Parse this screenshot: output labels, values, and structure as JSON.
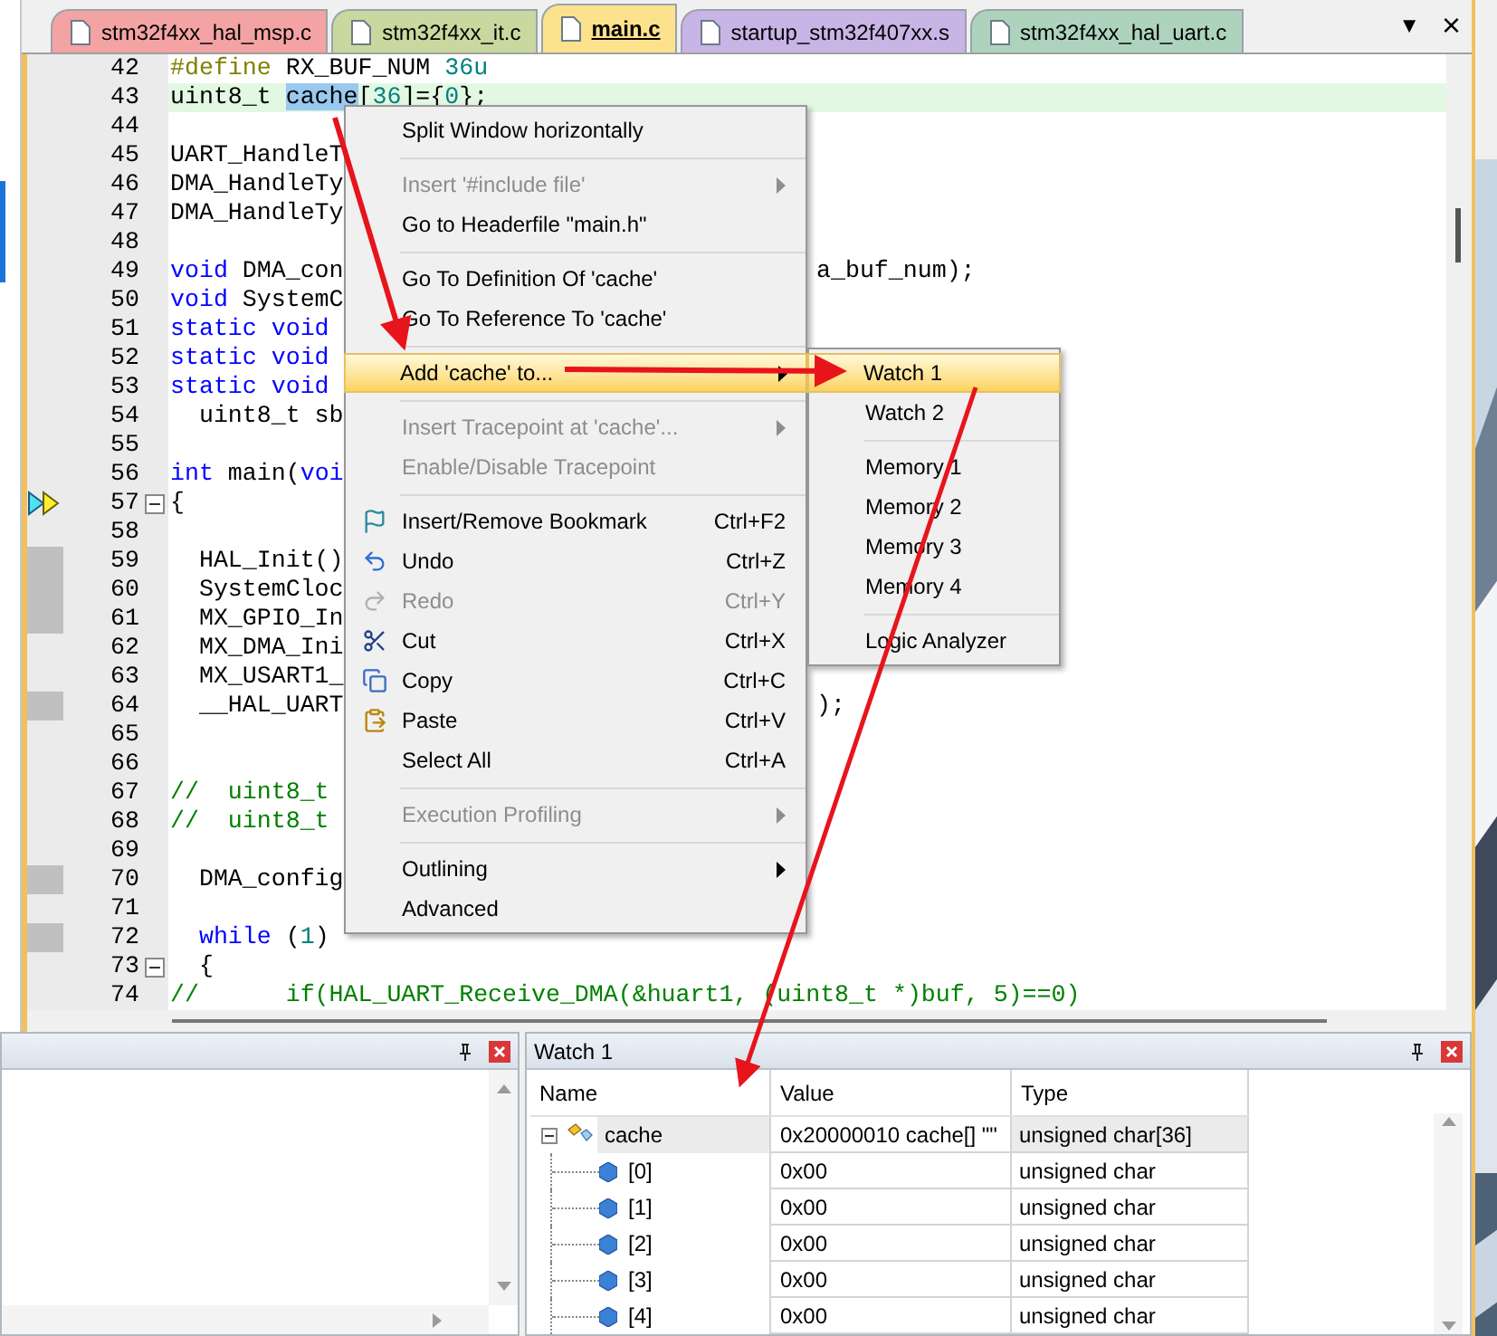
{
  "tabs": [
    {
      "label": "stm32f4xx_hal_msp.c",
      "color": "#f3a3a3",
      "selected": false
    },
    {
      "label": "stm32f4xx_it.c",
      "color": "#c9d89e",
      "selected": false
    },
    {
      "label": "main.c",
      "color": "#fde28e",
      "selected": true
    },
    {
      "label": "startup_stm32f407xx.s",
      "color": "#c9b4e6",
      "selected": false
    },
    {
      "label": "stm32f4xx_hal_uart.c",
      "color": "#aed3bd",
      "selected": false
    }
  ],
  "tab_controls": [
    "▼",
    "×"
  ],
  "editor": {
    "lines": [
      {
        "number": "42",
        "fold": false,
        "current": false,
        "segments": [
          {
            "kind": "preproc",
            "text": "#define"
          },
          {
            "kind": "plain",
            "text": " RX_BUF_NUM "
          },
          {
            "kind": "number",
            "text": "36u"
          }
        ]
      },
      {
        "number": "43",
        "fold": false,
        "current": true,
        "segments": [
          {
            "kind": "plain",
            "text": "uint8_t "
          },
          {
            "kind": "selected",
            "text": "cache"
          },
          {
            "kind": "plain",
            "text": "["
          },
          {
            "kind": "number",
            "text": "36"
          },
          {
            "kind": "plain",
            "text": "]={"
          },
          {
            "kind": "number",
            "text": "0"
          },
          {
            "kind": "plain",
            "text": "};"
          }
        ]
      },
      {
        "number": "44",
        "fold": false,
        "current": false
      },
      {
        "number": "45",
        "fold": false,
        "current": false,
        "segments": [
          {
            "kind": "plain",
            "text": "UART_HandleT"
          }
        ]
      },
      {
        "number": "46",
        "fold": false,
        "current": false,
        "segments": [
          {
            "kind": "plain",
            "text": "DMA_HandleTy"
          }
        ]
      },
      {
        "number": "47",
        "fold": false,
        "current": false,
        "segments": [
          {
            "kind": "plain",
            "text": "DMA_HandleTy"
          }
        ]
      },
      {
        "number": "48",
        "fold": false,
        "current": false
      },
      {
        "number": "49",
        "fold": false,
        "current": false,
        "segments": [
          {
            "kind": "keyword",
            "text": "void"
          },
          {
            "kind": "plain",
            "text": " DMA_con"
          }
        ],
        "tail": "a_buf_num);"
      },
      {
        "number": "50",
        "fold": false,
        "current": false,
        "segments": [
          {
            "kind": "keyword",
            "text": "void"
          },
          {
            "kind": "plain",
            "text": " SystemC"
          }
        ]
      },
      {
        "number": "51",
        "fold": false,
        "current": false,
        "segments": [
          {
            "kind": "keyword",
            "text": "static void"
          }
        ]
      },
      {
        "number": "52",
        "fold": false,
        "current": false,
        "segments": [
          {
            "kind": "keyword",
            "text": "static void"
          }
        ]
      },
      {
        "number": "53",
        "fold": false,
        "current": false,
        "segments": [
          {
            "kind": "keyword",
            "text": "static void"
          }
        ]
      },
      {
        "number": "54",
        "fold": false,
        "current": false,
        "segments": [
          {
            "kind": "plain",
            "text": "  uint8_t sb"
          }
        ]
      },
      {
        "number": "55",
        "fold": false,
        "current": false
      },
      {
        "number": "56",
        "fold": false,
        "current": false,
        "segments": [
          {
            "kind": "keyword",
            "text": "int"
          },
          {
            "kind": "plain",
            "text": " main("
          },
          {
            "kind": "keyword",
            "text": "voi"
          }
        ]
      },
      {
        "number": "57",
        "execution_point": true,
        "fold": true,
        "current": false,
        "segments": [
          {
            "kind": "plain",
            "text": "{"
          }
        ]
      },
      {
        "number": "58",
        "fold": false,
        "current": false
      },
      {
        "number": "59",
        "coverage": true,
        "fold": false,
        "current": false,
        "segments": [
          {
            "kind": "plain",
            "text": "  HAL_Init()"
          }
        ]
      },
      {
        "number": "60",
        "coverage": true,
        "fold": false,
        "current": false,
        "segments": [
          {
            "kind": "plain",
            "text": "  SystemCloc"
          }
        ]
      },
      {
        "number": "61",
        "coverage": true,
        "fold": false,
        "current": false,
        "segments": [
          {
            "kind": "plain",
            "text": "  MX_GPIO_In"
          }
        ]
      },
      {
        "number": "62",
        "fold": false,
        "current": false,
        "segments": [
          {
            "kind": "plain",
            "text": "  MX_DMA_Ini"
          }
        ]
      },
      {
        "number": "63",
        "fold": false,
        "current": false,
        "segments": [
          {
            "kind": "plain",
            "text": "  MX_USART1_"
          }
        ]
      },
      {
        "number": "64",
        "coverage": true,
        "fold": false,
        "current": false,
        "segments": [
          {
            "kind": "plain",
            "text": "  __HAL_UART"
          }
        ],
        "tail": ");"
      },
      {
        "number": "65",
        "fold": false,
        "current": false
      },
      {
        "number": "66",
        "fold": false,
        "current": false
      },
      {
        "number": "67",
        "fold": false,
        "current": false,
        "segments": [
          {
            "kind": "comment",
            "text": "//  uint8_t"
          }
        ]
      },
      {
        "number": "68",
        "fold": false,
        "current": false,
        "segments": [
          {
            "kind": "comment",
            "text": "//  uint8_t"
          }
        ]
      },
      {
        "number": "69",
        "fold": false,
        "current": false
      },
      {
        "number": "70",
        "coverage": true,
        "fold": false,
        "current": false,
        "segments": [
          {
            "kind": "plain",
            "text": "  DMA_config"
          }
        ]
      },
      {
        "number": "71",
        "fold": false,
        "current": false
      },
      {
        "number": "72",
        "coverage": true,
        "fold": false,
        "current": false,
        "segments": [
          {
            "kind": "keyword",
            "text": "  while"
          },
          {
            "kind": "plain",
            "text": " ("
          },
          {
            "kind": "number",
            "text": "1"
          },
          {
            "kind": "plain",
            "text": ")"
          }
        ]
      },
      {
        "number": "73",
        "fold": true,
        "current": false,
        "segments": [
          {
            "kind": "plain",
            "text": "  {"
          }
        ]
      },
      {
        "number": "74",
        "fold": false,
        "current": false,
        "segments": [
          {
            "kind": "comment",
            "text": "//      if(HAL_UART_Receive_DMA(&huart1, (uint8_t *)buf, 5)==0)"
          }
        ]
      }
    ]
  },
  "context_menu": {
    "items": [
      {
        "kind": "item",
        "label": "Split Window horizontally",
        "disabled": false,
        "submenu": false,
        "selected": false
      },
      {
        "kind": "separator"
      },
      {
        "kind": "item",
        "label": "Insert '#include file'",
        "disabled": true,
        "submenu": true,
        "selected": false
      },
      {
        "kind": "item",
        "label": "Go to Headerfile \"main.h\"",
        "disabled": false,
        "submenu": false,
        "selected": false
      },
      {
        "kind": "separator"
      },
      {
        "kind": "item",
        "label": "Go To Definition Of 'cache'",
        "disabled": false,
        "submenu": false,
        "selected": false
      },
      {
        "kind": "item",
        "label": "Go To Reference To 'cache'",
        "disabled": false,
        "submenu": false,
        "selected": false
      },
      {
        "kind": "separator"
      },
      {
        "kind": "item",
        "label": "Add 'cache' to...",
        "disabled": false,
        "submenu": true,
        "selected": true
      },
      {
        "kind": "separator"
      },
      {
        "kind": "item",
        "label": "Insert Tracepoint at 'cache'...",
        "disabled": true,
        "submenu": true,
        "selected": false
      },
      {
        "kind": "item",
        "label": "Enable/Disable Tracepoint",
        "disabled": true,
        "submenu": false,
        "selected": false
      },
      {
        "kind": "separator"
      },
      {
        "kind": "item",
        "label": "Insert/Remove Bookmark",
        "shortcut": "Ctrl+F2",
        "disabled": false,
        "submenu": false,
        "selected": false
      },
      {
        "kind": "item",
        "label": "Undo",
        "shortcut": "Ctrl+Z",
        "disabled": false,
        "submenu": false,
        "selected": false
      },
      {
        "kind": "item",
        "label": "Redo",
        "shortcut": "Ctrl+Y",
        "disabled": true,
        "submenu": false,
        "selected": false
      },
      {
        "kind": "item",
        "label": "Cut",
        "shortcut": "Ctrl+X",
        "disabled": false,
        "submenu": false,
        "selected": false
      },
      {
        "kind": "item",
        "label": "Copy",
        "shortcut": "Ctrl+C",
        "disabled": false,
        "submenu": false,
        "selected": false
      },
      {
        "kind": "item",
        "label": "Paste",
        "shortcut": "Ctrl+V",
        "disabled": false,
        "submenu": false,
        "selected": false
      },
      {
        "kind": "item",
        "label": "Select All",
        "shortcut": "Ctrl+A",
        "disabled": false,
        "submenu": false,
        "selected": false
      },
      {
        "kind": "separator"
      },
      {
        "kind": "item",
        "label": "Execution Profiling",
        "disabled": true,
        "submenu": true,
        "selected": false
      },
      {
        "kind": "separator"
      },
      {
        "kind": "item",
        "label": "Outlining",
        "disabled": false,
        "submenu": true,
        "selected": false
      },
      {
        "kind": "item",
        "label": "Advanced",
        "disabled": false,
        "submenu": false,
        "selected": false
      }
    ]
  },
  "submenu": {
    "items": [
      {
        "kind": "item",
        "label": "Watch 1",
        "selected": true
      },
      {
        "kind": "item",
        "label": "Watch 2",
        "selected": false
      },
      {
        "kind": "separator"
      },
      {
        "kind": "item",
        "label": "Memory 1",
        "selected": false
      },
      {
        "kind": "item",
        "label": "Memory 2",
        "selected": false
      },
      {
        "kind": "item",
        "label": "Memory 3",
        "selected": false
      },
      {
        "kind": "item",
        "label": "Memory 4",
        "selected": false
      },
      {
        "kind": "separator"
      },
      {
        "kind": "item",
        "label": "Logic Analyzer",
        "selected": false
      }
    ]
  },
  "watch": {
    "title": "Watch 1",
    "columns": [
      "Name",
      "Value",
      "Type"
    ],
    "rows": [
      {
        "name": "cache",
        "value": "0x20000010 cache[] \"\"",
        "type": "unsigned char[36]",
        "expanded": true,
        "selected": true,
        "children": [
          {
            "name": "[0]",
            "value": "0x00",
            "type": "unsigned char",
            "selected": false
          },
          {
            "name": "[1]",
            "value": "0x00",
            "type": "unsigned char",
            "selected": false
          },
          {
            "name": "[2]",
            "value": "0x00",
            "type": "unsigned char",
            "selected": false
          },
          {
            "name": "[3]",
            "value": "0x00",
            "type": "unsigned char",
            "selected": false
          },
          {
            "name": "[4]",
            "value": "0x00",
            "type": "unsigned char",
            "selected": false
          }
        ]
      }
    ]
  }
}
